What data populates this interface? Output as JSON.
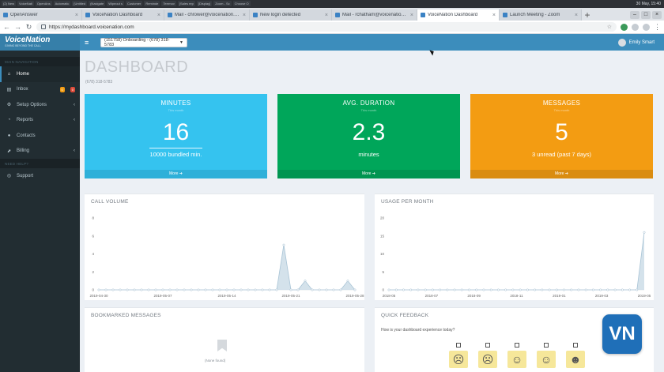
{
  "system_bar": {
    "items": [
      "(2) New",
      "VoiceNati",
      "OpenAns",
      "Automatic",
      "[Untitled",
      "(Navigate",
      "Wipeout s",
      "Customer",
      "Reminde",
      "Terrmov",
      "[Sales rep",
      "[Display]",
      "Zoom - Sc",
      "Choose O"
    ],
    "clock": "30 May, 15:40"
  },
  "tabs": [
    {
      "title": "OpenAnswer",
      "active": false
    },
    {
      "title": "VoiceNation Dashboard",
      "active": false
    },
    {
      "title": "Mail - chrower@voicenation.co...",
      "active": false
    },
    {
      "title": "New login detected",
      "active": false
    },
    {
      "title": "Mail - rchatham@voicenation.co...",
      "active": false
    },
    {
      "title": "VoiceNation Dashboard",
      "active": true
    },
    {
      "title": "Launch Meeting - Zoom",
      "active": false
    }
  ],
  "address": {
    "url": "https://mydashboard.voicenation.com"
  },
  "header": {
    "logo": "VoiceNation",
    "logo_tagline": "GIVING BEYOND THE CALL",
    "account": "(151758) Onboarding - (678) 318-5783",
    "user": "Emily Smart"
  },
  "sidebar": {
    "heading_main": "MAIN NAVIGATION",
    "heading_help": "NEED HELP?",
    "items": [
      {
        "label": "Home",
        "icon": "home-icon"
      },
      {
        "label": "Inbox",
        "icon": "inbox-icon",
        "badge1": "0",
        "badge2": "0"
      },
      {
        "label": "Setup Options",
        "icon": "gear-icon"
      },
      {
        "label": "Reports",
        "icon": "pie-chart-icon"
      },
      {
        "label": "Contacts",
        "icon": "user-icon"
      },
      {
        "label": "Billing",
        "icon": "billing-icon"
      },
      {
        "label": "Support",
        "icon": "support-icon"
      }
    ]
  },
  "page": {
    "title": "DASHBOARD",
    "subtitle": "(678) 318-5783"
  },
  "cards": [
    {
      "title": "MINUTES",
      "desc": "This month",
      "value": "16",
      "sub": "10000 bundled min.",
      "more": "More"
    },
    {
      "title": "AVG. DURATION",
      "desc": "This month",
      "value": "2.3",
      "sub": "minutes",
      "more": "More"
    },
    {
      "title": "MESSAGES",
      "desc": "This month",
      "value": "5",
      "sub": "3 unread (past 7 days)",
      "more": "More"
    }
  ],
  "panels": {
    "call_volume": "CALL VOLUME",
    "usage": "USAGE PER MONTH",
    "bookmarked": "BOOKMARKED MESSAGES",
    "bookmarked_empty": "(None found)",
    "feedback": "QUICK FEEDBACK",
    "feedback_question": "How is your dashboard experience today?"
  },
  "chart_data": [
    {
      "type": "area",
      "title": "CALL VOLUME",
      "ylim": [
        0,
        8
      ],
      "yticks": [
        0,
        2,
        4,
        6,
        8
      ],
      "x_tick_labels": [
        "2019-04-30",
        "2019-05-07",
        "2019-05-14",
        "2019-05-21",
        "2019-05-28"
      ],
      "values": [
        0,
        0,
        0,
        0,
        0,
        0,
        0,
        0,
        0,
        0,
        0,
        0,
        0,
        0,
        0,
        0,
        0,
        0,
        0,
        0,
        0,
        0,
        0,
        0,
        0,
        0,
        5,
        0,
        0,
        1,
        0,
        0,
        0,
        0,
        0,
        1,
        0
      ],
      "color": "#c9dbe6"
    },
    {
      "type": "area",
      "title": "USAGE PER MONTH",
      "ylim": [
        0,
        20
      ],
      "yticks": [
        0,
        5,
        10,
        15,
        20
      ],
      "x_tick_labels": [
        "2018-05",
        "2018-07",
        "2018-09",
        "2018-11",
        "2019-01",
        "2019-03",
        "2019-05"
      ],
      "values": [
        0,
        0,
        0,
        0,
        0,
        0,
        0,
        0,
        0,
        0,
        0,
        0,
        0,
        0,
        0,
        0,
        0,
        0,
        0,
        0,
        0,
        0,
        0,
        0,
        0,
        0,
        0,
        0,
        0,
        0,
        0,
        0,
        0,
        0,
        0,
        16
      ],
      "color": "#c9dbe6"
    }
  ],
  "feedback_faces": [
    "very-unhappy-face-icon",
    "unhappy-face-icon",
    "neutral-face-icon",
    "happy-face-icon",
    "very-happy-face-icon"
  ],
  "vn_badge": "VN"
}
